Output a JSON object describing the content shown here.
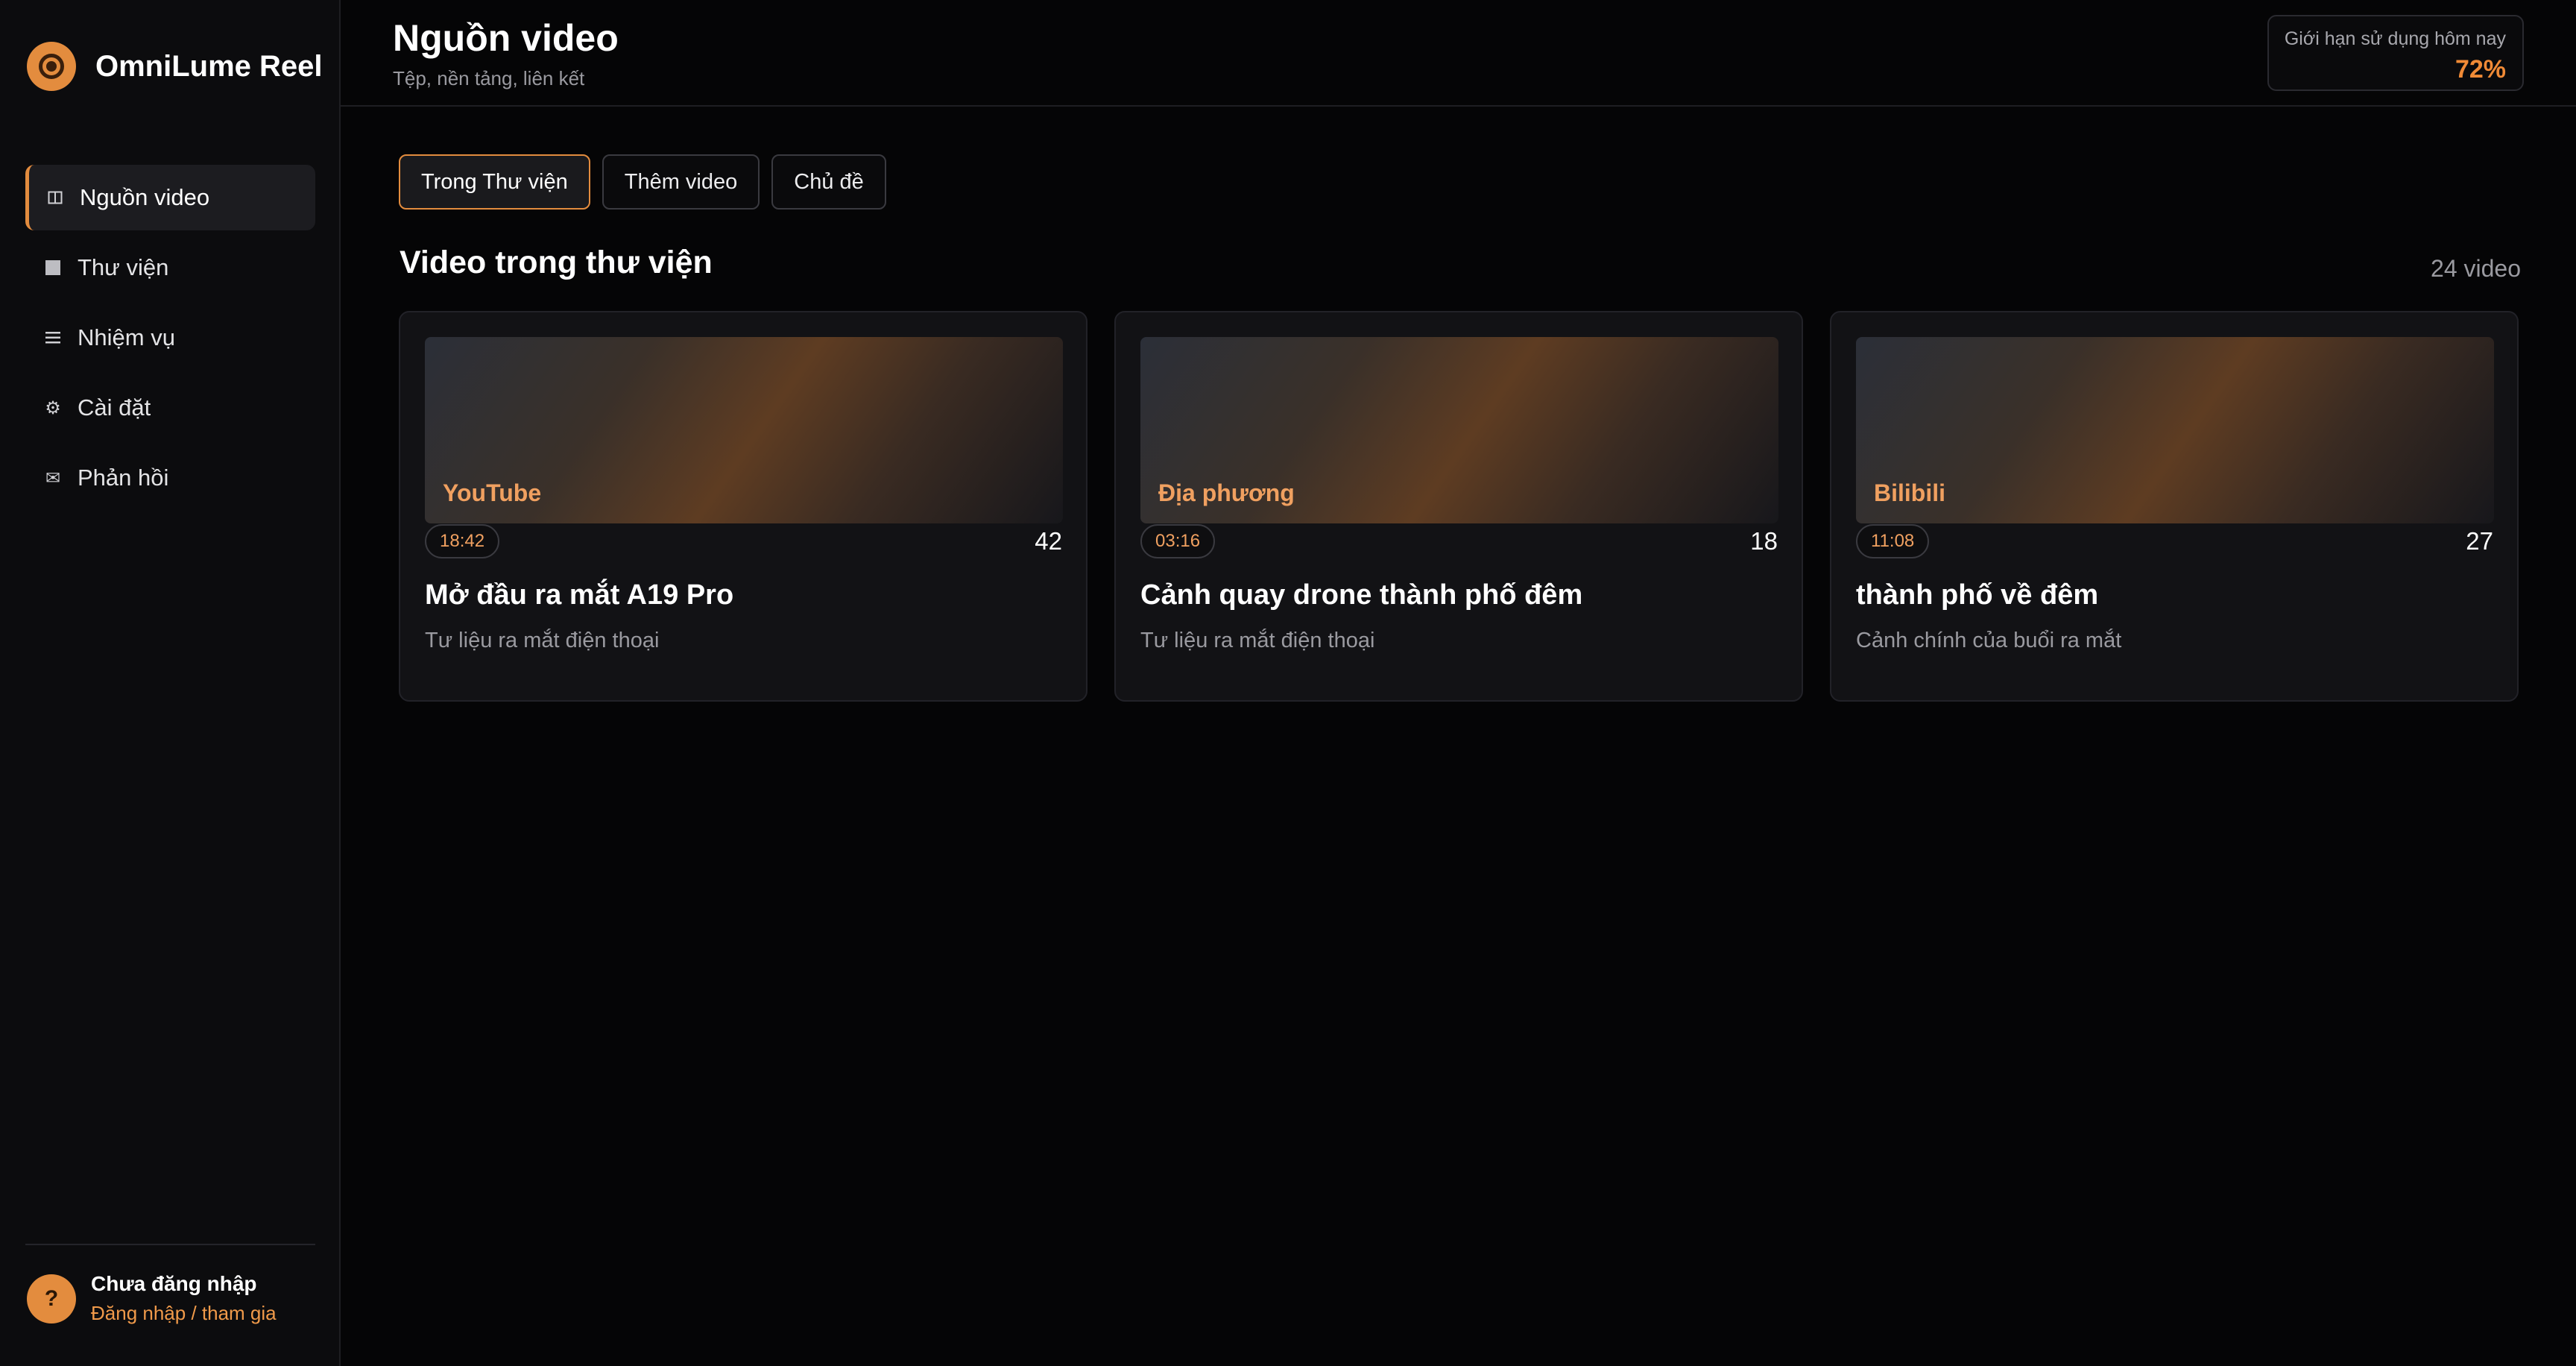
{
  "app": {
    "name": "OmniLume Reel"
  },
  "sidebar": {
    "items": [
      {
        "label": "Nguồn video",
        "icon": "columns-icon"
      },
      {
        "label": "Thư viện",
        "icon": "square-icon"
      },
      {
        "label": "Nhiệm vụ",
        "icon": "list-icon"
      },
      {
        "label": "Cài đặt",
        "icon": "gear-icon"
      },
      {
        "label": "Phản hồi",
        "icon": "mail-icon"
      }
    ],
    "user": {
      "avatar_glyph": "?",
      "name": "Chưa đăng nhập",
      "link": "Đăng nhập / tham gia"
    }
  },
  "header": {
    "title": "Nguồn video",
    "subtitle": "Tệp, nền tảng, liên kết",
    "usage": {
      "label": "Giới hạn sử dụng hôm nay",
      "value": "72%"
    }
  },
  "tabs": [
    {
      "label": "Trong Thư viện"
    },
    {
      "label": "Thêm video"
    },
    {
      "label": "Chủ đề"
    }
  ],
  "section": {
    "title": "Video trong thư viện",
    "count": "24 video"
  },
  "cards": [
    {
      "source": "YouTube",
      "duration": "18:42",
      "count": "42",
      "title": "Mở đầu ra mắt A19 Pro",
      "description": "Tư liệu ra mắt điện thoại"
    },
    {
      "source": "Địa phương",
      "duration": "03:16",
      "count": "18",
      "title": "Cảnh quay drone thành phố đêm",
      "description": "Tư liệu ra mắt điện thoại"
    },
    {
      "source": "Bilibili",
      "duration": "11:08",
      "count": "27",
      "title": "thành phố về đêm",
      "description": "Cảnh chính của buổi ra mắt"
    }
  ],
  "colors": {
    "accent": "#e38c3e",
    "background": "#050506",
    "sidebar": "#0c0c0e",
    "card": "#121215"
  }
}
